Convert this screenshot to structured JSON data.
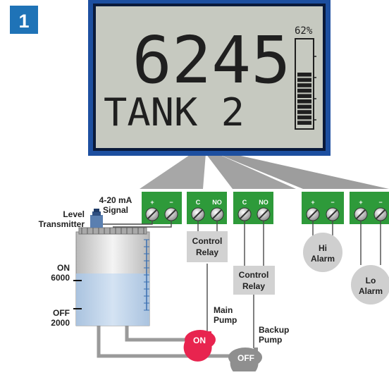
{
  "badge": {
    "number": "1",
    "color": "#1f73b7"
  },
  "display": {
    "value": "6245",
    "percent": "62%",
    "label": "TANK  2",
    "level_fraction": 0.62,
    "frame_color": "#1d4fa0",
    "screen_color": "#c6c9c0"
  },
  "terminals": {
    "signal": {
      "left": "+",
      "right": "−"
    },
    "relay1": {
      "left": "C",
      "right": "NO"
    },
    "relay2": {
      "left": "C",
      "right": "NO"
    },
    "hi": {
      "left": "+",
      "right": "−"
    },
    "lo": {
      "left": "+",
      "right": "−"
    },
    "color": "#2e9a3a"
  },
  "labels": {
    "signal": [
      "4-20 mA",
      "Signal"
    ],
    "transmitter": [
      "Level",
      "Transmitter"
    ],
    "on_level": [
      "ON",
      "6000"
    ],
    "off_level": [
      "OFF",
      "2000"
    ],
    "relay1": [
      "Control",
      "Relay"
    ],
    "relay2": [
      "Control",
      "Relay"
    ],
    "hi_alarm": [
      "Hi",
      "Alarm"
    ],
    "lo_alarm": [
      "Lo",
      "Alarm"
    ],
    "main_pump": [
      "Main",
      "Pump"
    ],
    "backup_pump": [
      "Backup",
      "Pump"
    ],
    "pump_on": "ON",
    "pump_off": "OFF"
  },
  "colors": {
    "pump_on": "#e8244f",
    "pump_off": "#8f8f8f",
    "liquid": "#c2d6ec",
    "pipe": "#9a9a9a",
    "alarm": "#cfcfcf"
  }
}
